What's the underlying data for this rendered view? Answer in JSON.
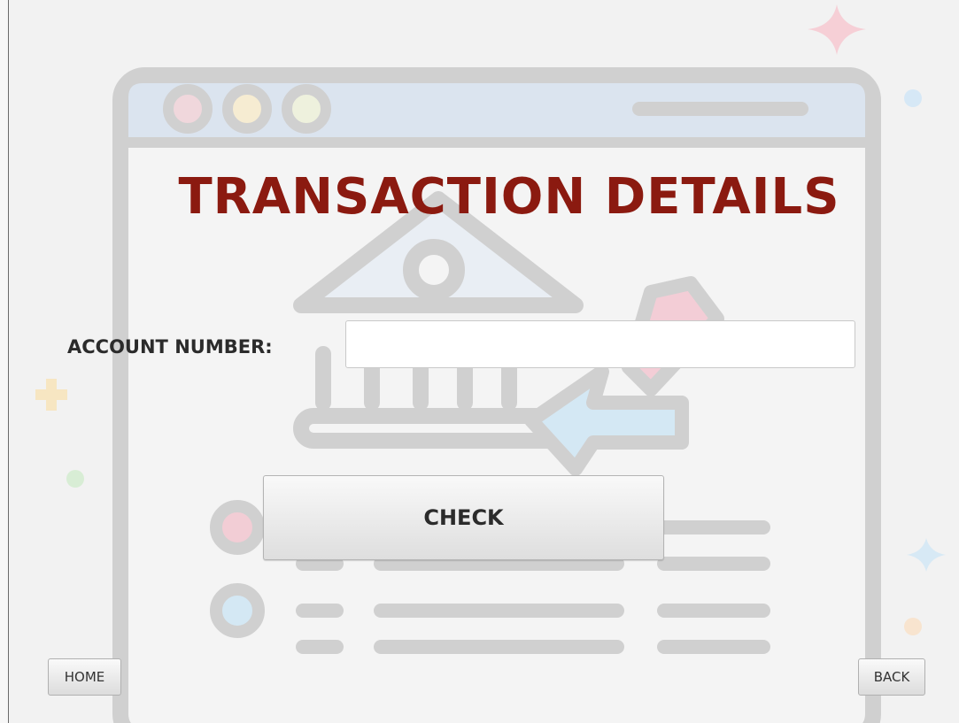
{
  "page": {
    "title": "TRANSACTION DETAILS"
  },
  "form": {
    "account_label": "ACCOUNT NUMBER:",
    "account_value": "",
    "account_placeholder": ""
  },
  "buttons": {
    "check_label": "CHECK",
    "home_label": "HOME",
    "back_label": "BACK"
  },
  "theme": {
    "title_color": "#8b1a10",
    "background_color": "#f2f2f2"
  },
  "background_art": {
    "icon": "bank-transfer-browser-illustration"
  }
}
